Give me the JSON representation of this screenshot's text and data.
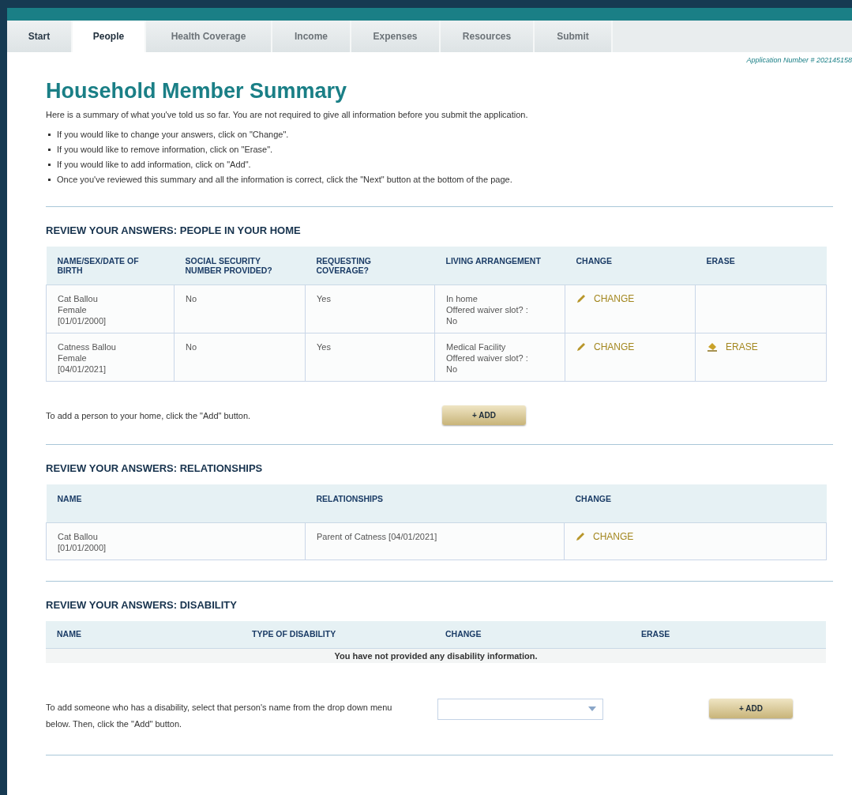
{
  "tabs": [
    {
      "label": "Start",
      "selected": false
    },
    {
      "label": "People",
      "selected": true
    },
    {
      "label": "Health Coverage",
      "selected": false
    },
    {
      "label": "Income",
      "selected": false
    },
    {
      "label": "Expenses",
      "selected": false
    },
    {
      "label": "Resources",
      "selected": false
    },
    {
      "label": "Submit",
      "selected": false
    }
  ],
  "application_number": "Application Number # 202145158",
  "title": "Household Member Summary",
  "intro": "Here is a summary of what you've told us so far. You are not required to give all information before you submit the application.",
  "bullets": [
    "If you would like to change your answers, click on \"Change\".",
    "If you would like to remove information, click on \"Erase\".",
    "If you would like to add information, click on \"Add\".",
    "Once you've reviewed this summary and all the information is correct, click the \"Next\" button at the bottom of the page."
  ],
  "people": {
    "heading": "REVIEW YOUR ANSWERS: PEOPLE IN YOUR HOME",
    "columns": [
      "NAME/SEX/DATE OF BIRTH",
      "SOCIAL SECURITY NUMBER PROVIDED?",
      "REQUESTING COVERAGE?",
      "LIVING ARRANGEMENT",
      "CHANGE",
      "ERASE"
    ],
    "rows": [
      {
        "cells": [
          {
            "kind": "text",
            "lines": [
              "Cat Ballou",
              "Female",
              "[01/01/2000]"
            ]
          },
          {
            "kind": "text",
            "lines": [
              "No"
            ]
          },
          {
            "kind": "text",
            "lines": [
              "Yes"
            ]
          },
          {
            "kind": "text",
            "lines": [
              "In home",
              "Offered waiver slot? :",
              "No"
            ]
          },
          {
            "kind": "change",
            "label": "CHANGE"
          },
          {
            "kind": "empty"
          }
        ]
      },
      {
        "cells": [
          {
            "kind": "text",
            "lines": [
              "Catness Ballou",
              "Female",
              "[04/01/2021]"
            ]
          },
          {
            "kind": "text",
            "lines": [
              "No"
            ]
          },
          {
            "kind": "text",
            "lines": [
              "Yes"
            ]
          },
          {
            "kind": "text",
            "lines": [
              "Medical Facility",
              "Offered waiver slot? :",
              "No"
            ]
          },
          {
            "kind": "change",
            "label": "CHANGE"
          },
          {
            "kind": "erase",
            "label": "ERASE"
          }
        ]
      }
    ],
    "add_note": "To add a person to your home, click the \"Add\" button.",
    "add_button": "+ ADD"
  },
  "relationships": {
    "heading": "REVIEW YOUR ANSWERS: RELATIONSHIPS",
    "columns": [
      "NAME",
      "RELATIONSHIPS",
      "CHANGE"
    ],
    "rows": [
      {
        "cells": [
          {
            "kind": "text",
            "lines": [
              "Cat Ballou",
              "[01/01/2000]"
            ]
          },
          {
            "kind": "text",
            "lines": [
              "Parent of Catness [04/01/2021]"
            ]
          },
          {
            "kind": "change",
            "label": "CHANGE"
          }
        ]
      }
    ]
  },
  "disability": {
    "heading": "REVIEW YOUR ANSWERS: DISABILITY",
    "columns": [
      "NAME",
      "TYPE OF DISABILITY",
      "CHANGE",
      "ERASE"
    ],
    "empty_message": "You have not provided any disability information.",
    "add_note": "To add someone who has a disability, select that person's name from the drop down menu below. Then, click the \"Add\" button.",
    "add_button": "+ ADD"
  }
}
